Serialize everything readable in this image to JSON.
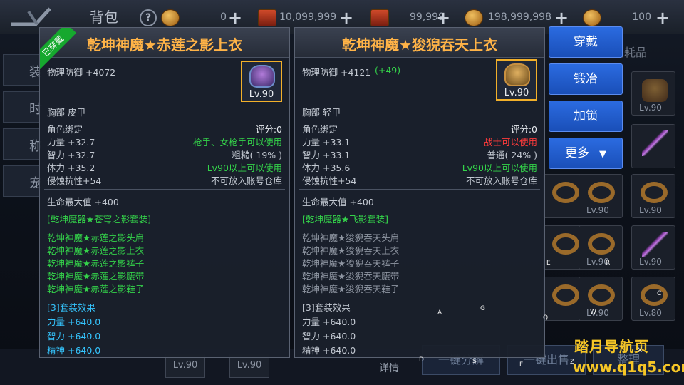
{
  "top_bar": {
    "title": "背包",
    "help": "?",
    "currencies": [
      {
        "icon": "gold-coin-icon",
        "value": "0"
      },
      {
        "icon": "scroll-icon",
        "value": "10,099,999"
      },
      {
        "icon": "scroll-icon",
        "value": "99,999"
      },
      {
        "icon": "gold-coin-icon",
        "value": "198,999,998"
      },
      {
        "icon": "gold-coin-icon",
        "value": "100"
      }
    ],
    "plus": "+"
  },
  "left_tabs": [
    "装",
    "时",
    "称",
    "宠"
  ],
  "background": {
    "consumable_tab": "消耗品",
    "slot_levels": [
      "Lv.90",
      "Lv.90",
      "Lv.90",
      "Lv.90",
      "Lv.90",
      "Lv.90",
      "Lv.90",
      "Lv.90",
      "Lv.80"
    ],
    "bottom_slots": [
      "Lv.90",
      "Lv.90"
    ],
    "detail_btn": "详情",
    "bottom_btn_1": "一键分解",
    "bottom_btn_2": "一键出售",
    "bottom_btn_3": "整理"
  },
  "equipped_item": {
    "badge": "已穿戴",
    "name": "乾坤神魔★赤莲之影上衣",
    "defense": "物理防御 +4072",
    "level": "Lv.90",
    "slot_type": "胸部 皮甲",
    "bind": "角色绑定",
    "score": "评分:0",
    "stats": [
      {
        "label": "力量 +32.7",
        "right": "枪手、女枪手可以使用",
        "right_color": "green"
      },
      {
        "label": "智力 +32.7",
        "right": "粗糙( 19% )",
        "right_color": "gray"
      },
      {
        "label": "体力 +35.2",
        "right": "Lv90以上可以使用",
        "right_color": "green"
      },
      {
        "label": "侵蚀抗性+54",
        "right": "不可放入账号仓库",
        "right_color": "gray"
      }
    ],
    "hp": "生命最大值 +400",
    "set_name": "[乾坤魔器★苍穹之影套装]",
    "set_items": [
      "乾坤神魔★赤莲之影头肩",
      "乾坤神魔★赤莲之影上衣",
      "乾坤神魔★赤莲之影裤子",
      "乾坤神魔★赤莲之影腰带",
      "乾坤神魔★赤莲之影鞋子"
    ],
    "set_effect_title": "[3]套装效果",
    "set_effects": [
      "力量 +640.0",
      "智力 +640.0",
      "精神 +640.0"
    ]
  },
  "compare_item": {
    "name": "乾坤神魔★狻猊吞天上衣",
    "defense": "物理防御 +4121",
    "defense_diff": "(+49)",
    "level": "Lv.90",
    "slot_type": "胸部 轻甲",
    "bind": "角色绑定",
    "score": "评分:0",
    "stats": [
      {
        "label": "力量 +33.1",
        "right": "战士可以使用",
        "right_color": "red"
      },
      {
        "label": "智力 +33.1",
        "right": "普通( 24% )",
        "right_color": "gray"
      },
      {
        "label": "体力 +35.6",
        "right": "Lv90以上可以使用",
        "right_color": "green"
      },
      {
        "label": "侵蚀抗性+54",
        "right": "不可放入账号仓库",
        "right_color": "gray"
      }
    ],
    "hp": "生命最大值 +400",
    "set_name": "[乾坤魔器★飞影套装]",
    "set_items": [
      "乾坤神魔★狻猊吞天头肩",
      "乾坤神魔★狻猊吞天上衣",
      "乾坤神魔★狻猊吞天裤子",
      "乾坤神魔★狻猊吞天腰带",
      "乾坤神魔★狻猊吞天鞋子"
    ],
    "set_effect_title": "[3]套装效果",
    "set_effects": [
      "力量 +640.0",
      "智力 +640.0",
      "精神 +640.0"
    ]
  },
  "actions": {
    "wear": "穿戴",
    "forge": "锻冶",
    "lock": "加锁",
    "more": "更多",
    "more_arrow": "▼"
  },
  "watermark": {
    "line1": "踏月导航页",
    "line2": "www.q1q5.com"
  },
  "markers": [
    "E",
    "R",
    "C",
    "A",
    "G",
    "Q",
    "W",
    "D",
    "S",
    "F",
    "Z",
    "X"
  ]
}
